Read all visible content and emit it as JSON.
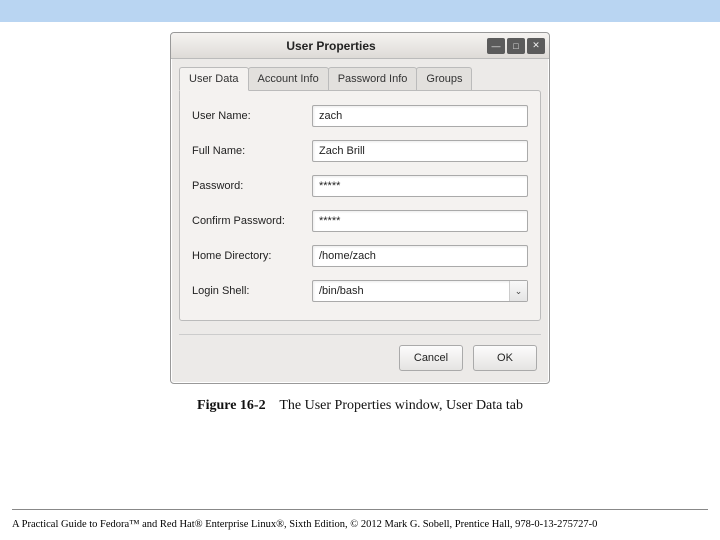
{
  "window": {
    "title": "User Properties",
    "tabs": [
      {
        "label": "User Data",
        "active": true
      },
      {
        "label": "Account Info",
        "active": false
      },
      {
        "label": "Password Info",
        "active": false
      },
      {
        "label": "Groups",
        "active": false
      }
    ],
    "fields": {
      "username": {
        "label": "User Name:",
        "value": "zach"
      },
      "fullname": {
        "label": "Full Name:",
        "value": "Zach Brill"
      },
      "password": {
        "label": "Password:",
        "value": "*****"
      },
      "confirm": {
        "label": "Confirm Password:",
        "value": "*****"
      },
      "homedir": {
        "label": "Home Directory:",
        "value": "/home/zach"
      },
      "shell": {
        "label": "Login Shell:",
        "value": "/bin/bash"
      }
    },
    "buttons": {
      "cancel": "Cancel",
      "ok": "OK"
    }
  },
  "caption": {
    "label": "Figure 16-2",
    "text": "The User Properties window, User Data tab"
  },
  "footer": "A Practical Guide to Fedora™ and Red Hat® Enterprise Linux®, Sixth Edition, © 2012 Mark G. Sobell, Prentice Hall, 978-0-13-275727-0"
}
